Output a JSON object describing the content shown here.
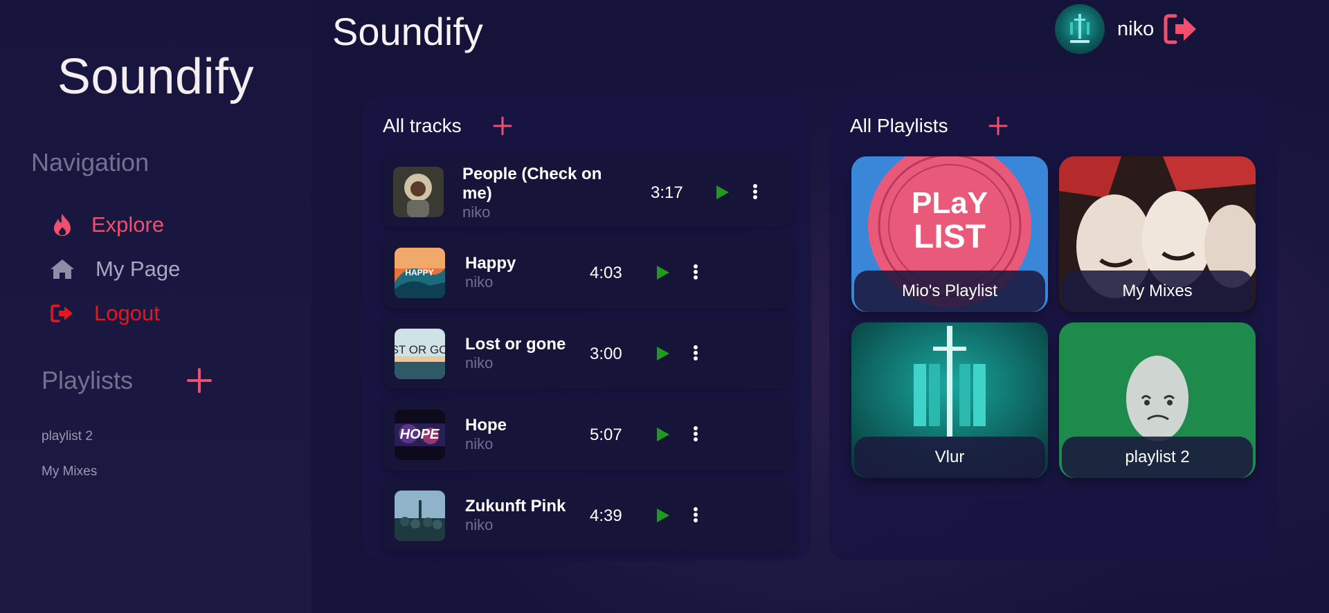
{
  "app": {
    "name": "Soundify"
  },
  "sidebar": {
    "logo": "Soundify",
    "nav_heading": "Navigation",
    "nav": [
      {
        "label": "Explore",
        "icon": "fire-icon",
        "color": "#f0506e"
      },
      {
        "label": "My Page",
        "icon": "home-icon",
        "color": "#a8a7c4"
      },
      {
        "label": "Logout",
        "icon": "logout-icon",
        "color": "#e8161b"
      }
    ],
    "playlists_heading": "Playlists",
    "playlists": [
      "playlist 2",
      "My Mixes"
    ]
  },
  "header": {
    "title": "Soundify",
    "user": {
      "name": "niko"
    }
  },
  "tracks_panel": {
    "title": "All tracks",
    "tracks": [
      {
        "title": "People (Check on me)",
        "artist": "niko",
        "duration": "3:17"
      },
      {
        "title": "Happy",
        "artist": "niko",
        "duration": "4:03"
      },
      {
        "title": "Lost or gone",
        "artist": "niko",
        "duration": "3:00"
      },
      {
        "title": "Hope",
        "artist": "niko",
        "duration": "5:07"
      },
      {
        "title": "Zukunft Pink",
        "artist": "niko",
        "duration": "4:39"
      }
    ]
  },
  "playlists_panel": {
    "title": "All Playlists",
    "playlists": [
      {
        "name": "Mio's Playlist"
      },
      {
        "name": "My Mixes"
      },
      {
        "name": "Vlur"
      },
      {
        "name": "playlist 2"
      }
    ]
  },
  "colors": {
    "accent": "#f0506e",
    "play": "#1f9a1f",
    "logout": "#e8161b",
    "background": "#15133a"
  }
}
